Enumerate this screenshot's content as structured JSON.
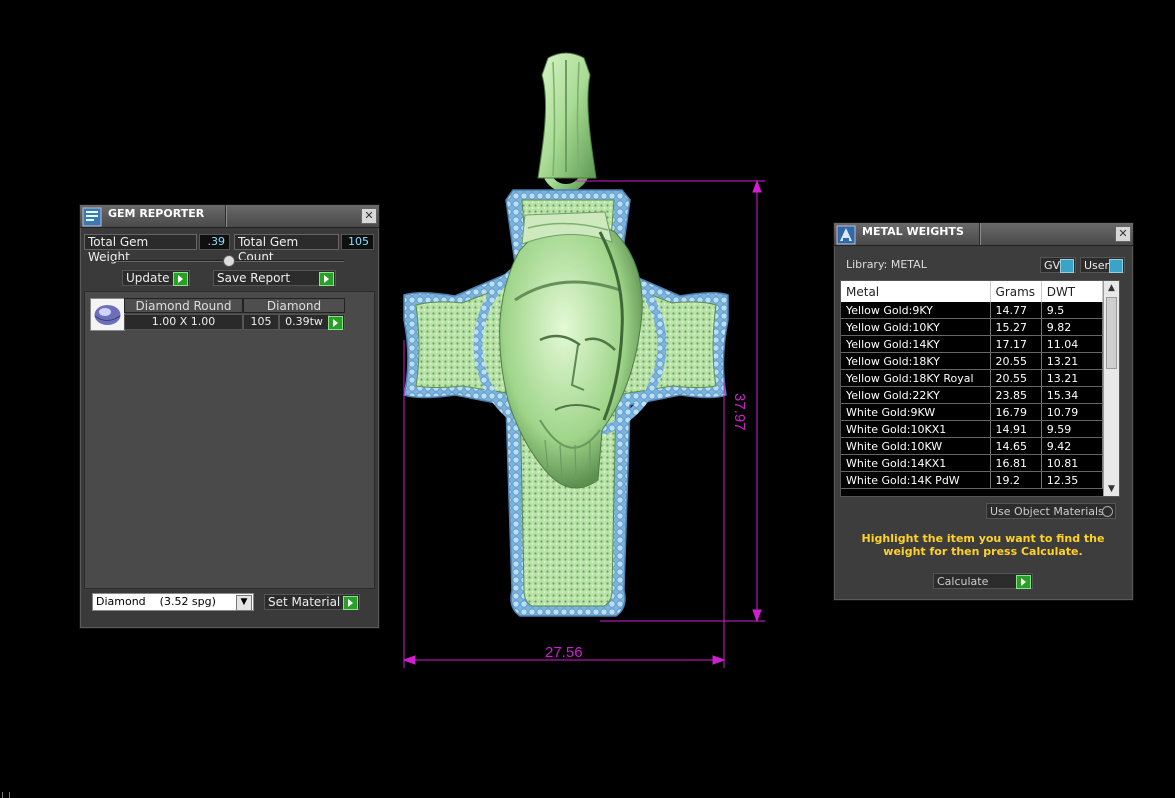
{
  "gem_reporter": {
    "title": "GEM REPORTER",
    "total_gem_weight_label": "Total Gem Weight",
    "total_gem_weight_value": ".39",
    "total_gem_count_label": "Total Gem Count",
    "total_gem_count_value": "105",
    "update_label": "Update",
    "save_report_label": "Save Report",
    "grid": {
      "header_name": "Diamond Round",
      "header_type": "Diamond",
      "size": "1.00 X 1.00",
      "count": "105",
      "weight": "0.39tw"
    },
    "material_select": "Diamond    (3.52 spg)",
    "set_material_label": "Set Material"
  },
  "metal_weights": {
    "title": "METAL WEIGHTS",
    "library_label": "Library: METAL",
    "gv_label": "GV",
    "user_label": "User",
    "columns": [
      "Metal",
      "Grams",
      "DWT"
    ],
    "rows": [
      [
        "Yellow Gold:9KY",
        "14.77",
        "9.5"
      ],
      [
        "Yellow Gold:10KY",
        "15.27",
        "9.82"
      ],
      [
        "Yellow Gold:14KY",
        "17.17",
        "11.04"
      ],
      [
        "Yellow Gold:18KY",
        "20.55",
        "13.21"
      ],
      [
        "Yellow Gold:18KY Royal",
        "20.55",
        "13.21"
      ],
      [
        "Yellow Gold:22KY",
        "23.85",
        "15.34"
      ],
      [
        "White Gold:9KW",
        "16.79",
        "10.79"
      ],
      [
        "White Gold:10KX1",
        "14.91",
        "9.59"
      ],
      [
        "White Gold:10KW",
        "14.65",
        "9.42"
      ],
      [
        "White Gold:14KX1",
        "16.81",
        "10.81"
      ],
      [
        "White Gold:14K PdW",
        "19.2",
        "12.35"
      ]
    ],
    "use_object_materials_label": "Use Object Materials",
    "instruction": "Highlight the item you want to find the weight for then press Calculate.",
    "calculate_label": "Calculate"
  },
  "dimensions": {
    "height": "37.97",
    "width": "27.56"
  },
  "colors": {
    "dimension_line": "#d21ed2",
    "model_green": "#b9e6a8",
    "gem_blue": "#8cc8f0",
    "panel_bg": "#3a3a3a",
    "instruction_text": "#ffd22a"
  }
}
